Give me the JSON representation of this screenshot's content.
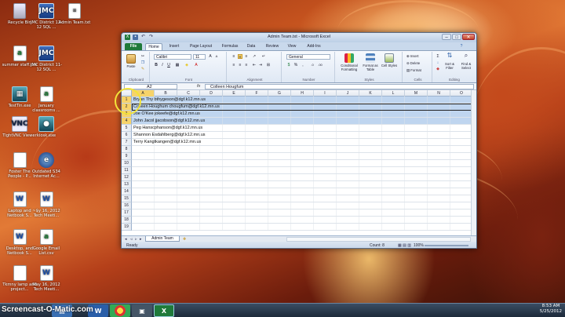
{
  "desktop_icons": [
    {
      "name": "recycle-bin-icon",
      "label": "Recycle Bin",
      "kind": "bin",
      "glyph": ""
    },
    {
      "name": "jmc-district-1-icon",
      "label": "JMC District 12-12 SQL ...",
      "kind": "jmc",
      "glyph": "JMC"
    },
    {
      "name": "admin-team-txt-icon",
      "label": "Admin Team.txt",
      "kind": "txt",
      "glyph": "≡"
    },
    {
      "name": "summer-staff-csv-icon",
      "label": "summer staff.csv",
      "kind": "csv",
      "glyph": "a"
    },
    {
      "name": "jmc-district-2-icon",
      "label": "JMC District 11-12 SQL ...",
      "kind": "jmc",
      "glyph": "JMC"
    },
    {
      "name": "testtin-exe-icon",
      "label": "TestTin.exe",
      "kind": "exe",
      "glyph": "▦"
    },
    {
      "name": "january-classrooms-icon",
      "label": "January classrooms ...",
      "kind": "csv",
      "glyph": "a"
    },
    {
      "name": "tightvnc-viewer-icon",
      "label": "TightVNC Viewer",
      "kind": "vnc",
      "glyph": "VNC"
    },
    {
      "name": "kiosk-exe-icon",
      "label": "kiosk.exe",
      "kind": "exe",
      "glyph": "●"
    },
    {
      "name": "foster-the-people-icon",
      "label": "Foster The People - P...",
      "kind": "ppt",
      "glyph": ""
    },
    {
      "name": "outdated-s34-icon",
      "label": "Outdated S34 Internet Ac...",
      "kind": "ie",
      "glyph": "e"
    },
    {
      "name": "laptop-netbook-1-icon",
      "label": "Laptop and Netbook S...",
      "kind": "doc",
      "glyph": "W"
    },
    {
      "name": "tech-meeting-1-icon",
      "label": "~$y 16, 2012 Tech Meeti...",
      "kind": "doc",
      "glyph": "W"
    },
    {
      "name": "laptop-netbook-2-icon",
      "label": "Desktop, and Netbook S...",
      "kind": "doc",
      "glyph": "W"
    },
    {
      "name": "google-email-list-icon",
      "label": "Google Email List.csv",
      "kind": "csv",
      "glyph": "a"
    },
    {
      "name": "tkmny-lamp-icon",
      "label": "Tkmny lamp and project...",
      "kind": "ppt",
      "glyph": ""
    },
    {
      "name": "tech-meeting-2-icon",
      "label": "May 16, 2012 Tech Meeti...",
      "kind": "doc",
      "glyph": "W"
    }
  ],
  "excel": {
    "window_title": "Admin Team.txt - Microsoft Excel",
    "tabs": [
      "File",
      "Home",
      "Insert",
      "Page Layout",
      "Formulas",
      "Data",
      "Review",
      "View",
      "Add-Ins"
    ],
    "ribbon": {
      "clipboard": {
        "label": "Clipboard",
        "paste": "Paste"
      },
      "font": {
        "label": "Font",
        "name": "Calibri",
        "size": "11"
      },
      "alignment": {
        "label": "Alignment"
      },
      "number": {
        "label": "Number",
        "format": "General"
      },
      "styles": {
        "label": "Styles",
        "conditional": "Conditional Formatting",
        "format_table": "Format as Table",
        "cell_styles": "Cell Styles"
      },
      "cells": {
        "label": "Cells",
        "insert": "Insert",
        "delete": "Delete",
        "format": "Format"
      },
      "editing": {
        "label": "Editing",
        "sort": "Sort & Filter",
        "find": "Find & Select"
      }
    },
    "name_box": "A2",
    "fx": "fx",
    "formula": "Colleen Hougfum",
    "columns": [
      "A",
      "B",
      "C",
      "D",
      "E",
      "F",
      "G",
      "H",
      "I",
      "J",
      "K",
      "L",
      "M",
      "N",
      "O"
    ],
    "rows": [
      {
        "num": "1",
        "text": "Bryan Thy bthygeson@dgf.k12.mn.us",
        "selected": true
      },
      {
        "num": "2",
        "text": "Colleen Houghum chougfum@dgf.k12.mn.us",
        "selected": true
      },
      {
        "num": "3",
        "text": "Joe O'Kee jokeefe@dgf.k12.mn.us",
        "selected": true
      },
      {
        "num": "4",
        "text": "John Jacol jjacobson@dgf.k12.mn.us",
        "selected": true
      },
      {
        "num": "5",
        "text": "Peg Hanscphanson@dgf.k12.mn.us",
        "selected": false
      },
      {
        "num": "6",
        "text": "Shannon Esdahlberg@dgf.k12.mn.us",
        "selected": false
      },
      {
        "num": "7",
        "text": "Terry Kangtkangen@dgf.k12.mn.us",
        "selected": false
      },
      {
        "num": "8",
        "text": "",
        "selected": false
      },
      {
        "num": "9",
        "text": "",
        "selected": false
      },
      {
        "num": "10",
        "text": "",
        "selected": false
      },
      {
        "num": "11",
        "text": "",
        "selected": false
      },
      {
        "num": "12",
        "text": "",
        "selected": false
      },
      {
        "num": "13",
        "text": "",
        "selected": false
      },
      {
        "num": "14",
        "text": "",
        "selected": false
      },
      {
        "num": "15",
        "text": "",
        "selected": false
      },
      {
        "num": "16",
        "text": "",
        "selected": false
      },
      {
        "num": "17",
        "text": "",
        "selected": false
      },
      {
        "num": "18",
        "text": "",
        "selected": false
      },
      {
        "num": "19",
        "text": "",
        "selected": false
      }
    ],
    "sheet_tab": "Admin Team",
    "status_ready": "Ready",
    "status_count": "Count: 8",
    "zoom": "100%"
  },
  "taskbar": {
    "watermark": "Screencast-O-Matic.com",
    "time": "8:53 AM",
    "date": "5/25/2012"
  },
  "colors": {
    "excel_green": "#1f7a3a",
    "selection": "#bfd5ef",
    "highlight_circle": "#f2e33a"
  }
}
